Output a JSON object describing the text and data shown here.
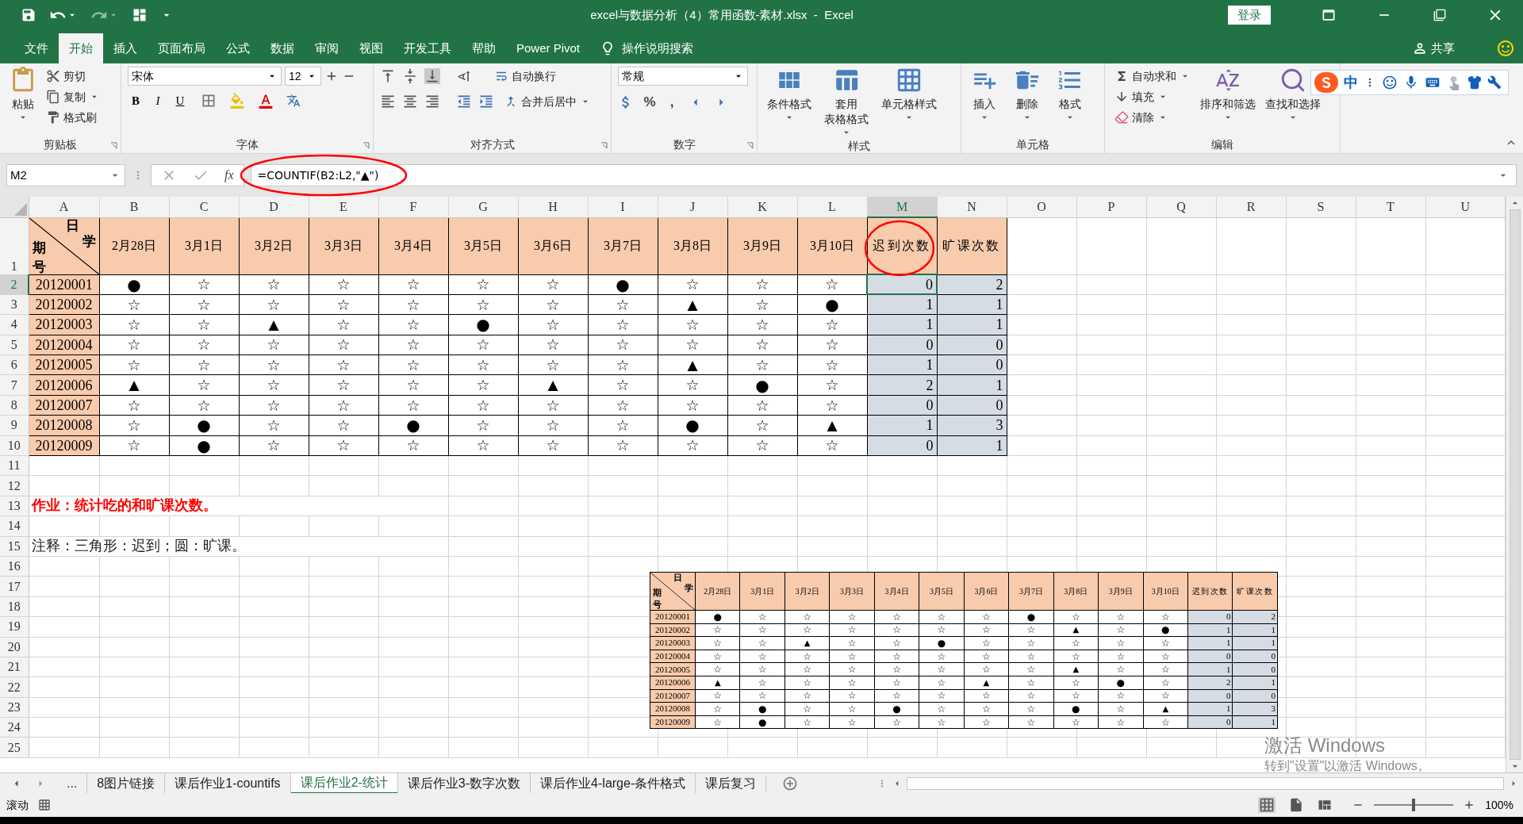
{
  "window": {
    "title": "excel与数据分析（4）常用函数-素材.xlsx  -  Excel",
    "login": "登录"
  },
  "menu_tabs": [
    {
      "label": "文件",
      "selected": false
    },
    {
      "label": "开始",
      "selected": true
    },
    {
      "label": "插入",
      "selected": false
    },
    {
      "label": "页面布局",
      "selected": false
    },
    {
      "label": "公式",
      "selected": false
    },
    {
      "label": "数据",
      "selected": false
    },
    {
      "label": "审阅",
      "selected": false
    },
    {
      "label": "视图",
      "selected": false
    },
    {
      "label": "开发工具",
      "selected": false
    },
    {
      "label": "帮助",
      "selected": false
    },
    {
      "label": "Power Pivot",
      "selected": false
    }
  ],
  "tell_me": "操作说明搜索",
  "share": "共享",
  "ribbon": {
    "clipboard": {
      "label": "剪贴板",
      "paste": "粘贴",
      "items": [
        "剪切",
        "复制",
        "格式刷"
      ]
    },
    "font": {
      "label": "字体",
      "name": "宋体",
      "size": "12",
      "styles": [
        "B",
        "I",
        "U"
      ]
    },
    "alignment": {
      "label": "对齐方式",
      "wrap": "自动换行",
      "merge": "合并后居中"
    },
    "number": {
      "label": "数字",
      "format": "常规",
      "symbols": [
        "%",
        ","
      ]
    },
    "styles": {
      "label": "样式",
      "items": [
        {
          "lines": [
            "条件格式"
          ]
        },
        {
          "lines": [
            "套用",
            "表格格式"
          ]
        },
        {
          "lines": [
            "单元格样式"
          ]
        }
      ]
    },
    "cells": {
      "label": "单元格",
      "items": [
        "插入",
        "删除",
        "格式"
      ]
    },
    "editing": {
      "label": "编辑",
      "small": [
        "自动求和",
        "填充",
        "清除"
      ],
      "big": [
        "排序和筛选",
        "查找和选择"
      ]
    }
  },
  "ime_toolbar": {
    "mode": "中"
  },
  "formula_bar": {
    "name_box": "M2",
    "insert_function": "fx",
    "formula": "=COUNTIF(B2:L2,\"▲\")"
  },
  "sheet": {
    "columns": [
      {
        "label": "A",
        "selected": false
      },
      {
        "label": "B",
        "selected": false
      },
      {
        "label": "C",
        "selected": false
      },
      {
        "label": "D",
        "selected": false
      },
      {
        "label": "E",
        "selected": false
      },
      {
        "label": "F",
        "selected": false
      },
      {
        "label": "G",
        "selected": false
      },
      {
        "label": "H",
        "selected": false
      },
      {
        "label": "I",
        "selected": false
      },
      {
        "label": "J",
        "selected": false
      },
      {
        "label": "K",
        "selected": false
      },
      {
        "label": "L",
        "selected": false
      },
      {
        "label": "M",
        "selected": true
      },
      {
        "label": "N",
        "selected": false
      },
      {
        "label": "O",
        "selected": false
      },
      {
        "label": "P",
        "selected": false
      },
      {
        "label": "Q",
        "selected": false
      },
      {
        "label": "R",
        "selected": false
      },
      {
        "label": "S",
        "selected": false
      },
      {
        "label": "T",
        "selected": false
      },
      {
        "label": "U",
        "selected": false
      }
    ],
    "rows": [
      {
        "label": "1",
        "selected": false
      },
      {
        "label": "2",
        "selected": true
      },
      {
        "label": "3",
        "selected": false
      },
      {
        "label": "4",
        "selected": false
      },
      {
        "label": "5",
        "selected": false
      },
      {
        "label": "6",
        "selected": false
      },
      {
        "label": "7",
        "selected": false
      },
      {
        "label": "8",
        "selected": false
      },
      {
        "label": "9",
        "selected": false
      },
      {
        "label": "10",
        "selected": false
      },
      {
        "label": "11",
        "selected": false
      },
      {
        "label": "12",
        "selected": false
      },
      {
        "label": "13",
        "selected": false
      },
      {
        "label": "14",
        "selected": false
      },
      {
        "label": "15",
        "selected": false
      },
      {
        "label": "16",
        "selected": false
      },
      {
        "label": "17",
        "selected": false
      },
      {
        "label": "18",
        "selected": false
      },
      {
        "label": "19",
        "selected": false
      },
      {
        "label": "20",
        "selected": false
      },
      {
        "label": "21",
        "selected": false
      },
      {
        "label": "22",
        "selected": false
      },
      {
        "label": "23",
        "selected": false
      },
      {
        "label": "24",
        "selected": false
      },
      {
        "label": "25",
        "selected": false
      }
    ],
    "table": {
      "corner": [
        "日",
        "学",
        "期",
        "号"
      ],
      "dates": [
        "2月28日",
        "3月1日",
        "3月2日",
        "3月3日",
        "3月4日",
        "3月5日",
        "3月6日",
        "3月7日",
        "3月8日",
        "3月9日",
        "3月10日"
      ],
      "totals": [
        "迟到次数",
        "旷课次数"
      ],
      "records": [
        {
          "id": "20120001",
          "marks": [
            "●",
            "☆",
            "☆",
            "☆",
            "☆",
            "☆",
            "☆",
            "●",
            "☆",
            "☆",
            "☆"
          ],
          "late": "0",
          "absent": "2"
        },
        {
          "id": "20120002",
          "marks": [
            "☆",
            "☆",
            "☆",
            "☆",
            "☆",
            "☆",
            "☆",
            "☆",
            "▲",
            "☆",
            "●"
          ],
          "late": "1",
          "absent": "1"
        },
        {
          "id": "20120003",
          "marks": [
            "☆",
            "☆",
            "▲",
            "☆",
            "☆",
            "●",
            "☆",
            "☆",
            "☆",
            "☆",
            "☆"
          ],
          "late": "1",
          "absent": "1"
        },
        {
          "id": "20120004",
          "marks": [
            "☆",
            "☆",
            "☆",
            "☆",
            "☆",
            "☆",
            "☆",
            "☆",
            "☆",
            "☆",
            "☆"
          ],
          "late": "0",
          "absent": "0"
        },
        {
          "id": "20120005",
          "marks": [
            "☆",
            "☆",
            "☆",
            "☆",
            "☆",
            "☆",
            "☆",
            "☆",
            "▲",
            "☆",
            "☆"
          ],
          "late": "1",
          "absent": "0"
        },
        {
          "id": "20120006",
          "marks": [
            "▲",
            "☆",
            "☆",
            "☆",
            "☆",
            "☆",
            "▲",
            "☆",
            "☆",
            "●",
            "☆"
          ],
          "late": "2",
          "absent": "1"
        },
        {
          "id": "20120007",
          "marks": [
            "☆",
            "☆",
            "☆",
            "☆",
            "☆",
            "☆",
            "☆",
            "☆",
            "☆",
            "☆",
            "☆"
          ],
          "late": "0",
          "absent": "0"
        },
        {
          "id": "20120008",
          "marks": [
            "☆",
            "●",
            "☆",
            "☆",
            "●",
            "☆",
            "☆",
            "☆",
            "●",
            "☆",
            "▲"
          ],
          "late": "1",
          "absent": "3"
        },
        {
          "id": "20120009",
          "marks": [
            "☆",
            "●",
            "☆",
            "☆",
            "☆",
            "☆",
            "☆",
            "☆",
            "☆",
            "☆",
            "☆"
          ],
          "late": "0",
          "absent": "1"
        }
      ]
    },
    "notes": [
      {
        "kind": "task",
        "text": "作业：统计吃的和旷课次数。"
      },
      {
        "kind": "note",
        "text": "注释：三角形：迟到；圆：旷课。"
      }
    ],
    "pasted_table": {
      "corner": [
        "日",
        "学",
        "期",
        "号"
      ],
      "dates": [
        "2月28日",
        "3月1日",
        "3月2日",
        "3月3日",
        "3月4日",
        "3月5日",
        "3月6日",
        "3月7日",
        "3月8日",
        "3月9日",
        "3月10日"
      ],
      "totals": [
        "迟到次数",
        "旷课次数"
      ],
      "records": [
        {
          "id": "20120001",
          "marks": [
            "●",
            "☆",
            "☆",
            "☆",
            "☆",
            "☆",
            "☆",
            "●",
            "☆",
            "☆",
            "☆"
          ],
          "late": "0",
          "absent": "2"
        },
        {
          "id": "20120002",
          "marks": [
            "☆",
            "☆",
            "☆",
            "☆",
            "☆",
            "☆",
            "☆",
            "☆",
            "▲",
            "☆",
            "●"
          ],
          "late": "1",
          "absent": "1"
        },
        {
          "id": "20120003",
          "marks": [
            "☆",
            "☆",
            "▲",
            "☆",
            "☆",
            "●",
            "☆",
            "☆",
            "☆",
            "☆",
            "☆"
          ],
          "late": "1",
          "absent": "1"
        },
        {
          "id": "20120004",
          "marks": [
            "☆",
            "☆",
            "☆",
            "☆",
            "☆",
            "☆",
            "☆",
            "☆",
            "☆",
            "☆",
            "☆"
          ],
          "late": "0",
          "absent": "0"
        },
        {
          "id": "20120005",
          "marks": [
            "☆",
            "☆",
            "☆",
            "☆",
            "☆",
            "☆",
            "☆",
            "☆",
            "▲",
            "☆",
            "☆"
          ],
          "late": "1",
          "absent": "0"
        },
        {
          "id": "20120006",
          "marks": [
            "▲",
            "☆",
            "☆",
            "☆",
            "☆",
            "☆",
            "▲",
            "☆",
            "☆",
            "●",
            "☆"
          ],
          "late": "2",
          "absent": "1"
        },
        {
          "id": "20120007",
          "marks": [
            "☆",
            "☆",
            "☆",
            "☆",
            "☆",
            "☆",
            "☆",
            "☆",
            "☆",
            "☆",
            "☆"
          ],
          "late": "0",
          "absent": "0"
        },
        {
          "id": "20120008",
          "marks": [
            "☆",
            "●",
            "☆",
            "☆",
            "●",
            "☆",
            "☆",
            "☆",
            "●",
            "☆",
            "▲"
          ],
          "late": "1",
          "absent": "3"
        },
        {
          "id": "20120009",
          "marks": [
            "☆",
            "●",
            "☆",
            "☆",
            "☆",
            "☆",
            "☆",
            "☆",
            "☆",
            "☆",
            "☆"
          ],
          "late": "0",
          "absent": "1"
        }
      ]
    }
  },
  "sheet_tabs_more": "...",
  "sheet_tabs": [
    {
      "label": "8图片链接",
      "selected": false
    },
    {
      "label": "课后作业1-countifs",
      "selected": false
    },
    {
      "label": "课后作业2-统计",
      "selected": true
    },
    {
      "label": "课后作业3-数字次数",
      "selected": false
    },
    {
      "label": "课后作业4-large-条件格式",
      "selected": false
    },
    {
      "label": "课后复习",
      "selected": false
    }
  ],
  "activation_notice": {
    "title": "激活 Windows",
    "hint": "转到\"设置\"以激活 Windows。"
  },
  "status_bar": {
    "mode": "滚动",
    "zoom": "100%",
    "zoom_slider": {
      "level": 0.5
    }
  }
}
